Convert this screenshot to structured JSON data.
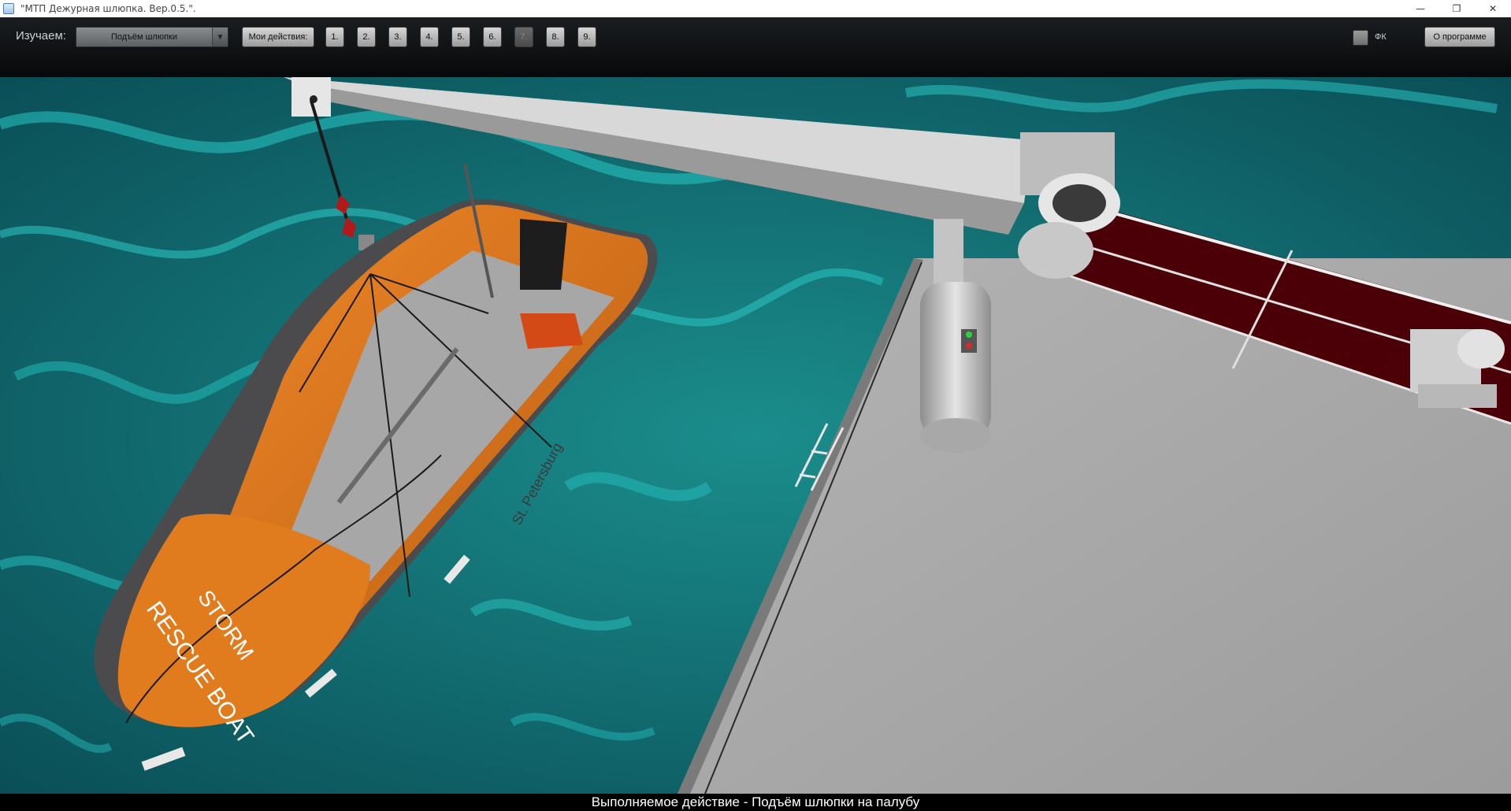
{
  "window": {
    "title": "\"МТП Дежурная шлюпка. Вер.0.5.\".",
    "minimize": "—",
    "restore": "❐",
    "close": "✕"
  },
  "toolbar": {
    "learn_label": "Изучаем:",
    "scenario_value": "Подъём шлюпки",
    "scenario_arrow": "▼",
    "my_actions_label": "Мои действия:",
    "steps": [
      "1.",
      "2.",
      "3.",
      "4.",
      "5.",
      "6.",
      "7.",
      "8.",
      "9."
    ],
    "disabled_step_index": 6,
    "fk_label": "ФК",
    "about_label": "О программе"
  },
  "scene": {
    "boat_name": "RESCUE BOAT",
    "boat_model": "STORM",
    "boat_port": "St. Petersburg"
  },
  "status": {
    "text": "Выполняемое действие - Подъём шлюпки на палубу"
  },
  "colors": {
    "sea": "#0f6f74",
    "boat_orange": "#e0761a",
    "boat_gray": "#4b4b4e",
    "deck": "#a8a8a8",
    "davit": "#d4d4d4",
    "rail_panel": "#4a0006"
  }
}
